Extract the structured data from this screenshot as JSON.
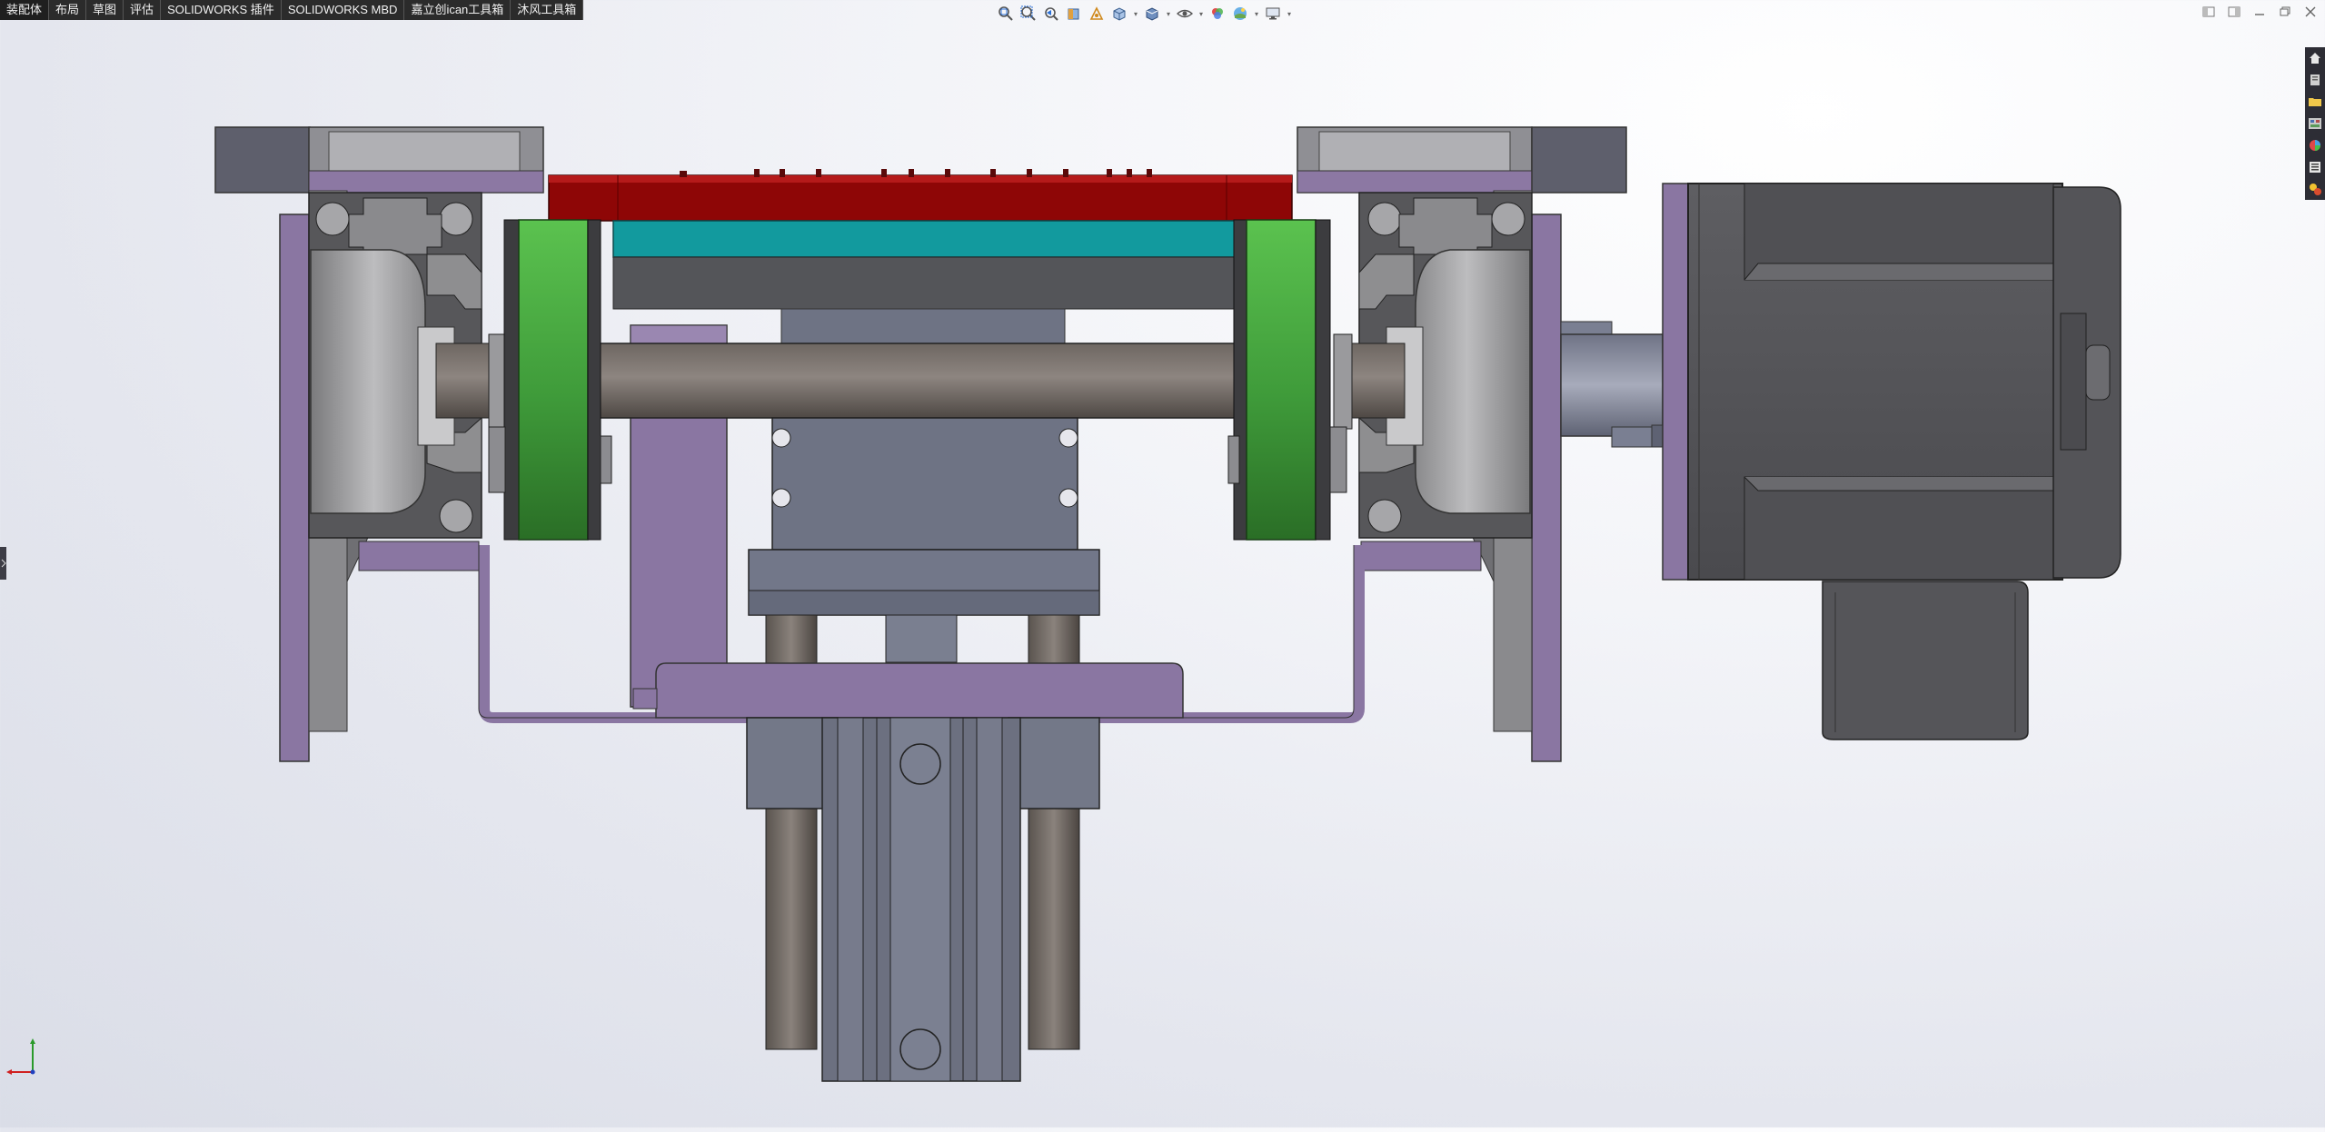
{
  "command_manager": {
    "tabs": [
      {
        "label": "装配体",
        "active": true
      },
      {
        "label": "布局",
        "active": false
      },
      {
        "label": "草图",
        "active": false
      },
      {
        "label": "评估",
        "active": false
      },
      {
        "label": "SOLIDWORKS 插件",
        "active": false
      },
      {
        "label": "SOLIDWORKS MBD",
        "active": false
      },
      {
        "label": "嘉立创ican工具箱",
        "active": false
      },
      {
        "label": "沐风工具箱",
        "active": false
      }
    ]
  },
  "heads_up_toolbar": {
    "icons": [
      "zoom-to-fit-icon",
      "zoom-to-area-icon",
      "previous-view-icon",
      "section-view-icon",
      "dynamic-annotation-icon",
      "view-orientation-icon",
      "display-style-icon",
      "hide-show-items-icon",
      "edit-appearance-icon",
      "apply-scene-icon",
      "view-settings-icon"
    ]
  },
  "window_controls": {
    "icons": [
      "tile-left-icon",
      "tile-right-icon",
      "minimize-icon",
      "restore-icon",
      "close-icon"
    ]
  },
  "task_pane": {
    "icons": [
      "home-icon",
      "design-library-icon",
      "file-explorer-icon",
      "view-palette-icon",
      "appearances-icon",
      "custom-properties-icon",
      "solidworks-resources-icon"
    ]
  },
  "colors": {
    "model_purple": "#8a76a2",
    "model_red": "#8e0606",
    "model_teal": "#129a9e",
    "model_green": "#42ac42",
    "model_dark_gray": "#545559",
    "model_steel": "#6b6f7d",
    "model_light_gray": "#a3a3a6",
    "toolbar_bg": "#2b2b2b"
  }
}
